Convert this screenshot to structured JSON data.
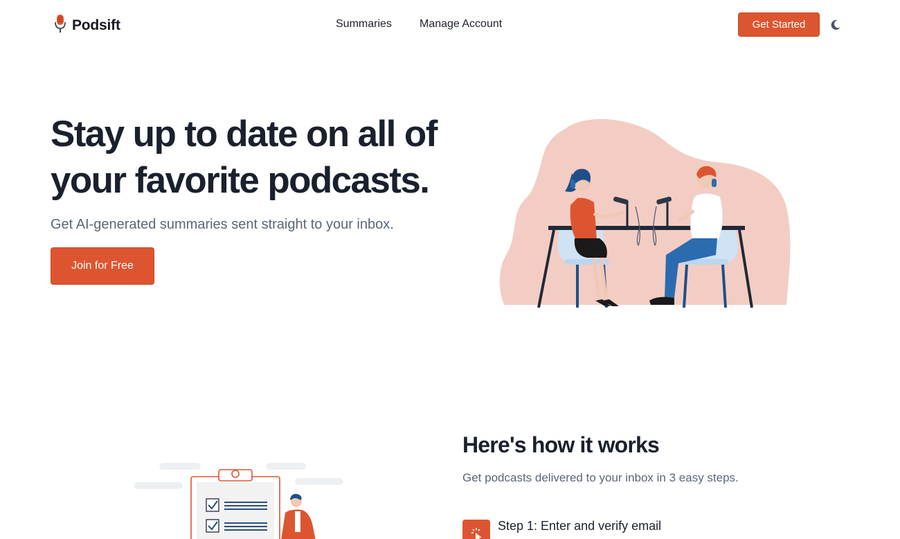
{
  "nav": {
    "brand": "Podsift",
    "brand_icon": "microphone-icon",
    "links": [
      "Summaries",
      "Manage Account"
    ],
    "cta": "Get Started",
    "theme_icon": "moon-icon"
  },
  "hero": {
    "title": "Stay up to date on all of your favorite podcasts.",
    "subtitle": "Get AI-generated summaries sent straight to your inbox.",
    "cta": "Join for Free",
    "illustration": "podcast-recording-illustration"
  },
  "how": {
    "title": "Here's how it works",
    "subtitle": "Get podcasts delivered to your inbox in 3 easy steps.",
    "steps": [
      {
        "label": "Step 1: Enter and verify email",
        "icon": "cursor-click-icon"
      }
    ],
    "illustration": "clipboard-checklist-illustration"
  },
  "colors": {
    "accent": "#dd5530",
    "heading": "#1a202c",
    "muted": "#5a6577",
    "blob": "#f3cdc3"
  }
}
